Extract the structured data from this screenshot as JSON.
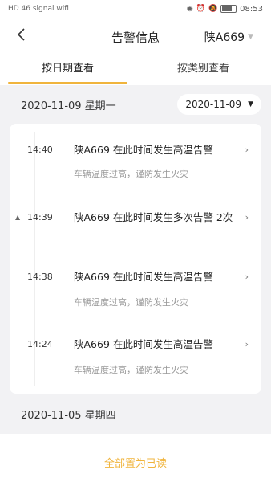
{
  "status": {
    "time": "08:53",
    "left_icons": "HD 46 signal wifi"
  },
  "header": {
    "title": "告警信息",
    "plate": "陕A669"
  },
  "tabs": [
    {
      "label": "按日期查看",
      "active": true
    },
    {
      "label": "按类别查看",
      "active": false
    }
  ],
  "group1": {
    "date_label": "2020-11-09 星期一",
    "picker_value": "2020-11-09"
  },
  "entries": [
    {
      "time": "14:40",
      "title": "陕A669 在此时间发生高温告警",
      "desc": "车辆温度过高，谨防发生火灾"
    },
    {
      "time": "14:39",
      "title": "陕A669 在此时间发生多次告警 2次",
      "desc": ""
    },
    {
      "time": "14:38",
      "title": "陕A669 在此时间发生高温告警",
      "desc": "车辆温度过高，谨防发生火灾"
    },
    {
      "time": "14:24",
      "title": "陕A669 在此时间发生高温告警",
      "desc": "车辆温度过高，谨防发生火灾"
    }
  ],
  "group2": {
    "date_label": "2020-11-05 星期四"
  },
  "footer": {
    "mark_all_read": "全部置为已读"
  },
  "colors": {
    "accent": "#f0b43c",
    "background": "#f2f2f4"
  }
}
